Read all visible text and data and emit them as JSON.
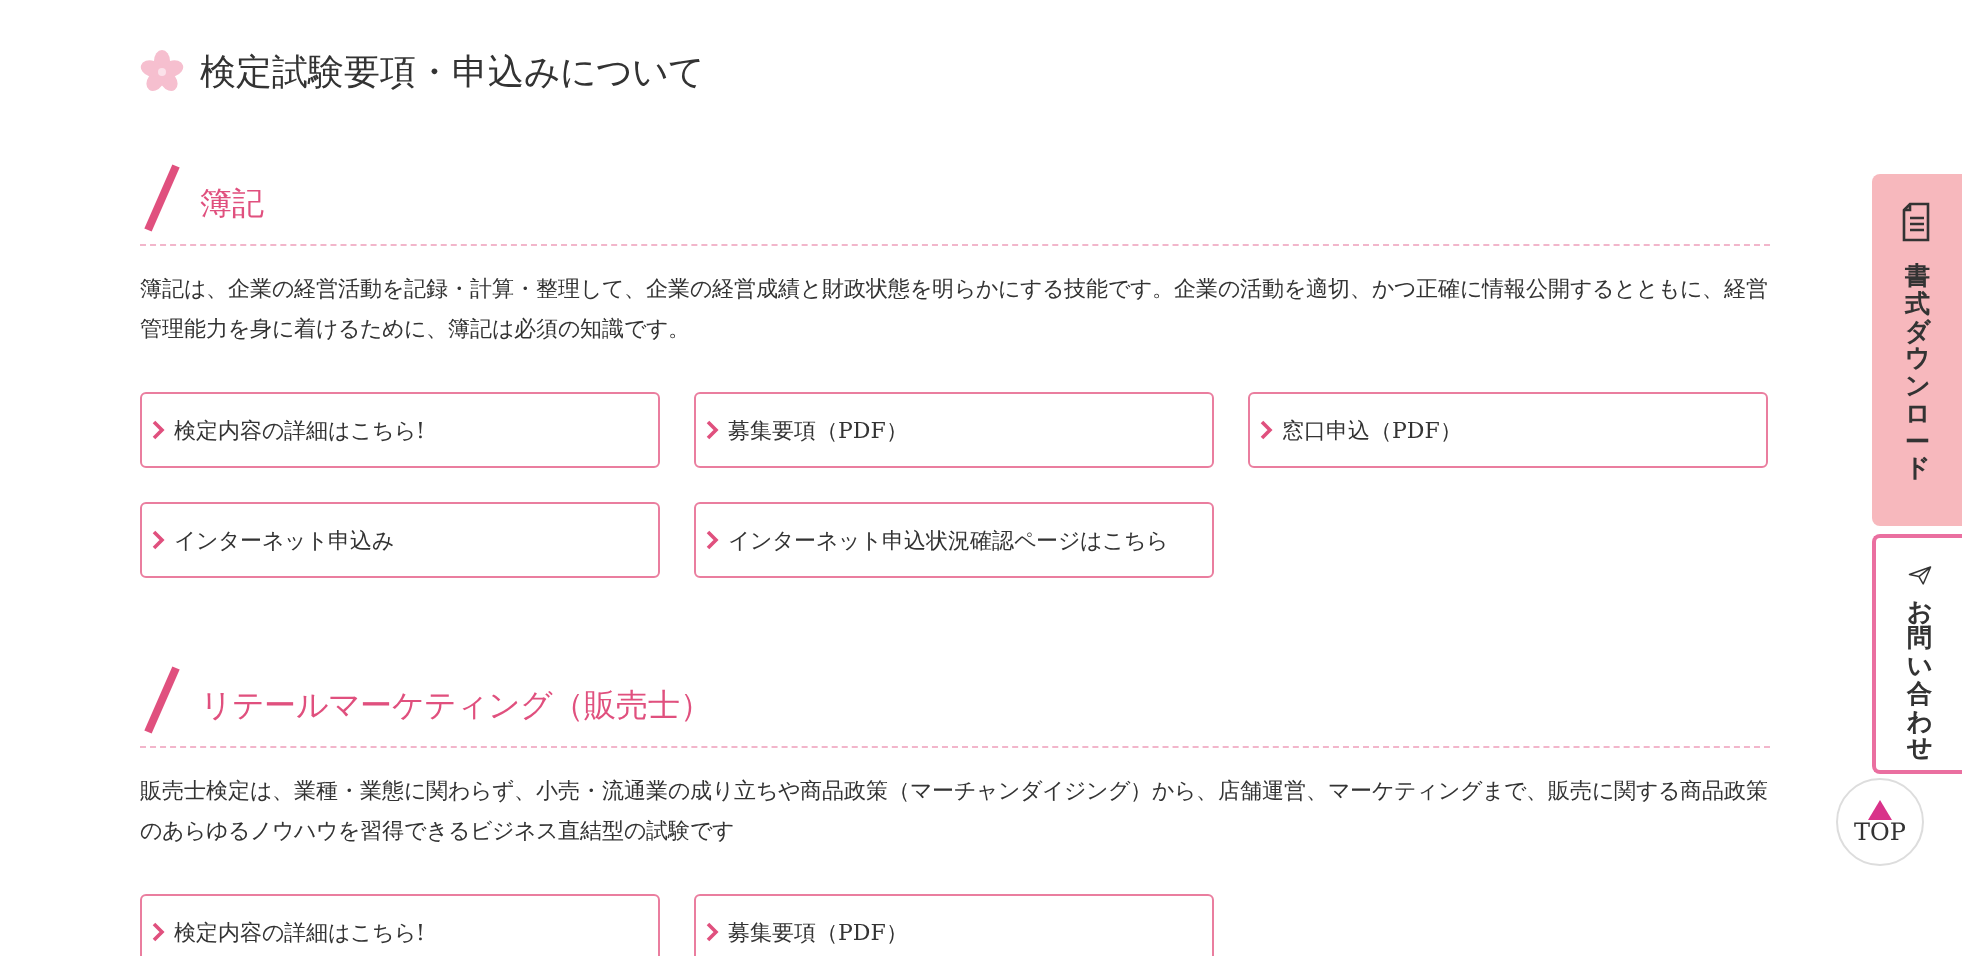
{
  "page_title": "検定試験要項・申込みについて",
  "sections": [
    {
      "heading": "簿記",
      "description": "簿記は、企業の経営活動を記録・計算・整理して、企業の経営成績と財政状態を明らかにする技能です。企業の活動を適切、かつ正確に情報公開するとともに、経営管理能力を身に着けるために、簿記は必須の知識です。",
      "links": [
        "検定内容の詳細はこちら!",
        "募集要項（PDF）",
        "窓口申込（PDF）",
        "インターネット申込み",
        "インターネット申込状況確認ページはこちら"
      ]
    },
    {
      "heading": "リテールマーケティング（販売士）",
      "description": "販売士検定は、業種・業態に関わらず、小売・流通業の成り立ちや商品政策（マーチャンダイジング）から、店舗運営、マーケティングまで、販売に関する商品政策のあらゆるノウハウを習得できるビジネス直結型の試験です",
      "links": [
        "検定内容の詳細はこちら!",
        "募集要項（PDF）"
      ]
    }
  ],
  "side_tabs": [
    {
      "kind": "download",
      "label": "書式ダウンロード"
    },
    {
      "kind": "contact",
      "label": "お問い合わせ"
    }
  ],
  "top_button": {
    "label": "TOP"
  }
}
